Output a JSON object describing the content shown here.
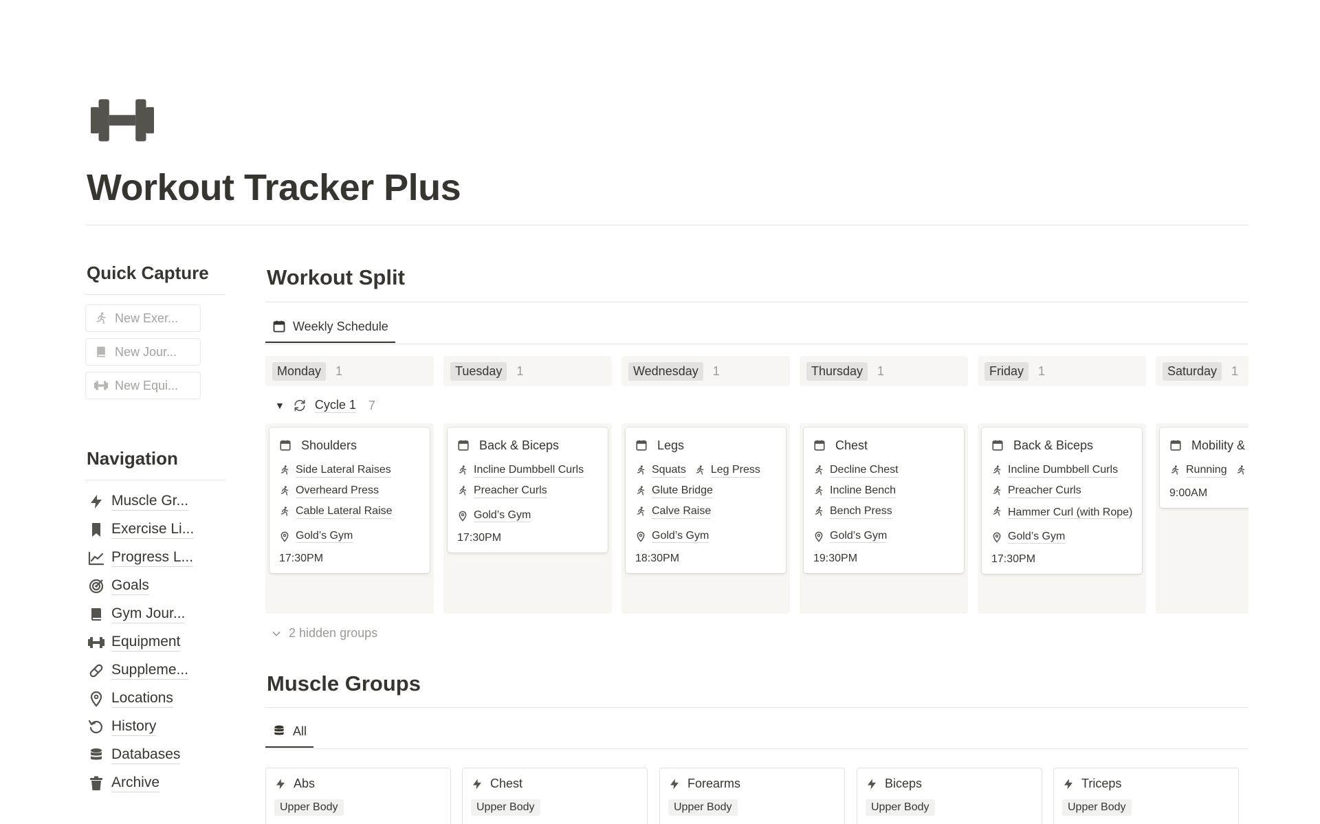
{
  "page": {
    "icon": "dumbbell-icon",
    "title": "Workout Tracker Plus"
  },
  "quick_capture": {
    "heading": "Quick Capture",
    "buttons": [
      {
        "label": "New Exer...",
        "icon": "runner-icon"
      },
      {
        "label": "New Jour...",
        "icon": "journal-icon"
      },
      {
        "label": "New Equi...",
        "icon": "dumbbell-icon"
      }
    ]
  },
  "navigation": {
    "heading": "Navigation",
    "items": [
      {
        "label": "Muscle Gr...",
        "icon": "bolt-icon"
      },
      {
        "label": "Exercise Li...",
        "icon": "bookmark-icon"
      },
      {
        "label": "Progress L...",
        "icon": "chart-line-icon"
      },
      {
        "label": "Goals",
        "icon": "target-icon"
      },
      {
        "label": "Gym Jour...",
        "icon": "journal-icon"
      },
      {
        "label": "Equipment",
        "icon": "dumbbell-icon"
      },
      {
        "label": "Suppleme...",
        "icon": "pill-icon"
      },
      {
        "label": "Locations",
        "icon": "pin-icon"
      },
      {
        "label": "History",
        "icon": "history-icon"
      },
      {
        "label": "Databases",
        "icon": "database-icon"
      },
      {
        "label": "Archive",
        "icon": "trash-icon"
      }
    ]
  },
  "workout_split": {
    "heading": "Workout Split",
    "view_tab": "Weekly Schedule",
    "group": {
      "label": "Cycle 1",
      "count": "7"
    },
    "hidden_groups": "2 hidden groups",
    "columns": [
      {
        "day": "Monday",
        "count": "1",
        "card": {
          "title": "Shoulders",
          "exercises": [
            "Side Lateral Raises",
            "Overheard Press",
            "Cable Lateral Raise"
          ],
          "location": "Gold’s Gym",
          "time": "17:30PM"
        }
      },
      {
        "day": "Tuesday",
        "count": "1",
        "card": {
          "title": "Back & Biceps",
          "exercises": [
            "Incline Dumbbell Curls",
            "Preacher Curls"
          ],
          "location": "Gold’s Gym",
          "time": "17:30PM"
        }
      },
      {
        "day": "Wednesday",
        "count": "1",
        "card": {
          "title": "Legs",
          "exercises": [
            "Squats",
            "Leg Press",
            "Glute Bridge",
            "Calve Raise"
          ],
          "location": "Gold’s Gym",
          "time": "18:30PM"
        }
      },
      {
        "day": "Thursday",
        "count": "1",
        "card": {
          "title": "Chest",
          "exercises": [
            "Decline Chest",
            "Incline Bench",
            "Bench Press"
          ],
          "location": "Gold’s Gym",
          "time": "19:30PM"
        }
      },
      {
        "day": "Friday",
        "count": "1",
        "card": {
          "title": "Back & Biceps",
          "exercises": [
            "Incline Dumbbell Curls",
            "Preacher Curls",
            "Hammer Curl (with Rope)"
          ],
          "location": "Gold’s Gym",
          "time": "17:30PM"
        }
      },
      {
        "day": "Saturday",
        "count": "1",
        "card": {
          "title": "Mobility & Stretching",
          "exercises": [
            "Running"
          ],
          "location": "",
          "time": "9:00AM"
        }
      }
    ]
  },
  "muscle_groups": {
    "heading": "Muscle Groups",
    "view_tab": "All",
    "cards": [
      {
        "title": "Abs",
        "tag": "Upper Body"
      },
      {
        "title": "Chest",
        "tag": "Upper Body"
      },
      {
        "title": "Forearms",
        "tag": "Upper Body"
      },
      {
        "title": "Biceps",
        "tag": "Upper Body"
      },
      {
        "title": "Triceps",
        "tag": "Upper Body"
      }
    ]
  },
  "colors": {
    "text": "#37352f",
    "muted": "#9b9a97",
    "column_bg": "#f7f6f3",
    "day_pill_bg": "#e3e2e0",
    "icon": "#55534e"
  }
}
